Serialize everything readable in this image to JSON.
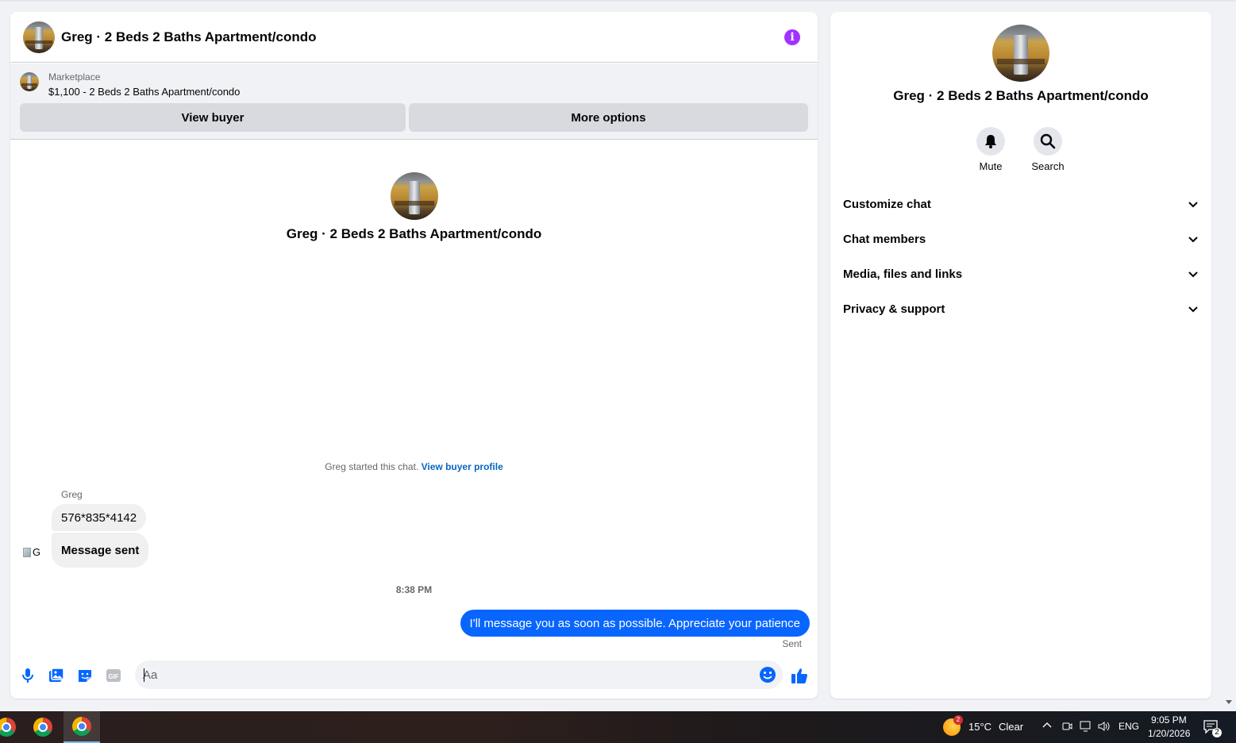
{
  "chat": {
    "title": "Greg · 2 Beds 2 Baths Apartment/condo",
    "info_icon": "info-icon",
    "marketplace": {
      "label": "Marketplace",
      "listing": "$1,100 - 2 Beds 2 Baths Apartment/condo",
      "view_buyer_label": "View buyer",
      "more_options_label": "More options"
    },
    "intro_name": "Greg · 2 Beds 2 Baths Apartment/condo",
    "started_text": "Greg started this chat.",
    "view_profile_link": "View buyer profile",
    "sender_name": "Greg",
    "avatar_alt": "G",
    "messages_in": [
      "576*835*4142",
      "Message sent"
    ],
    "timestamp": "8:38 PM",
    "message_out": "I'll message you as soon as possible. Appreciate your patience",
    "sent_status": "Sent",
    "composer": {
      "placeholder": "Aa",
      "icons": [
        "microphone-icon",
        "photo-icon",
        "sticker-icon",
        "gif-icon",
        "emoji-icon",
        "thumbs-up-icon"
      ]
    }
  },
  "info_panel": {
    "name": "Greg · 2 Beds 2 Baths Apartment/condo",
    "actions": [
      {
        "label": "Mute",
        "icon": "bell-icon"
      },
      {
        "label": "Search",
        "icon": "search-icon"
      }
    ],
    "sections": [
      "Customize chat",
      "Chat members",
      "Media, files and links",
      "Privacy & support"
    ]
  },
  "taskbar": {
    "weather": "15°C",
    "weather_condition": "Clear",
    "weather_badge": "2",
    "language": "ENG",
    "time": "9:05 PM",
    "date": "1/20/2026",
    "notification_count": "2"
  },
  "colors": {
    "accent": "#0866ff",
    "info": "#a033ff",
    "link": "#0a66c2"
  }
}
